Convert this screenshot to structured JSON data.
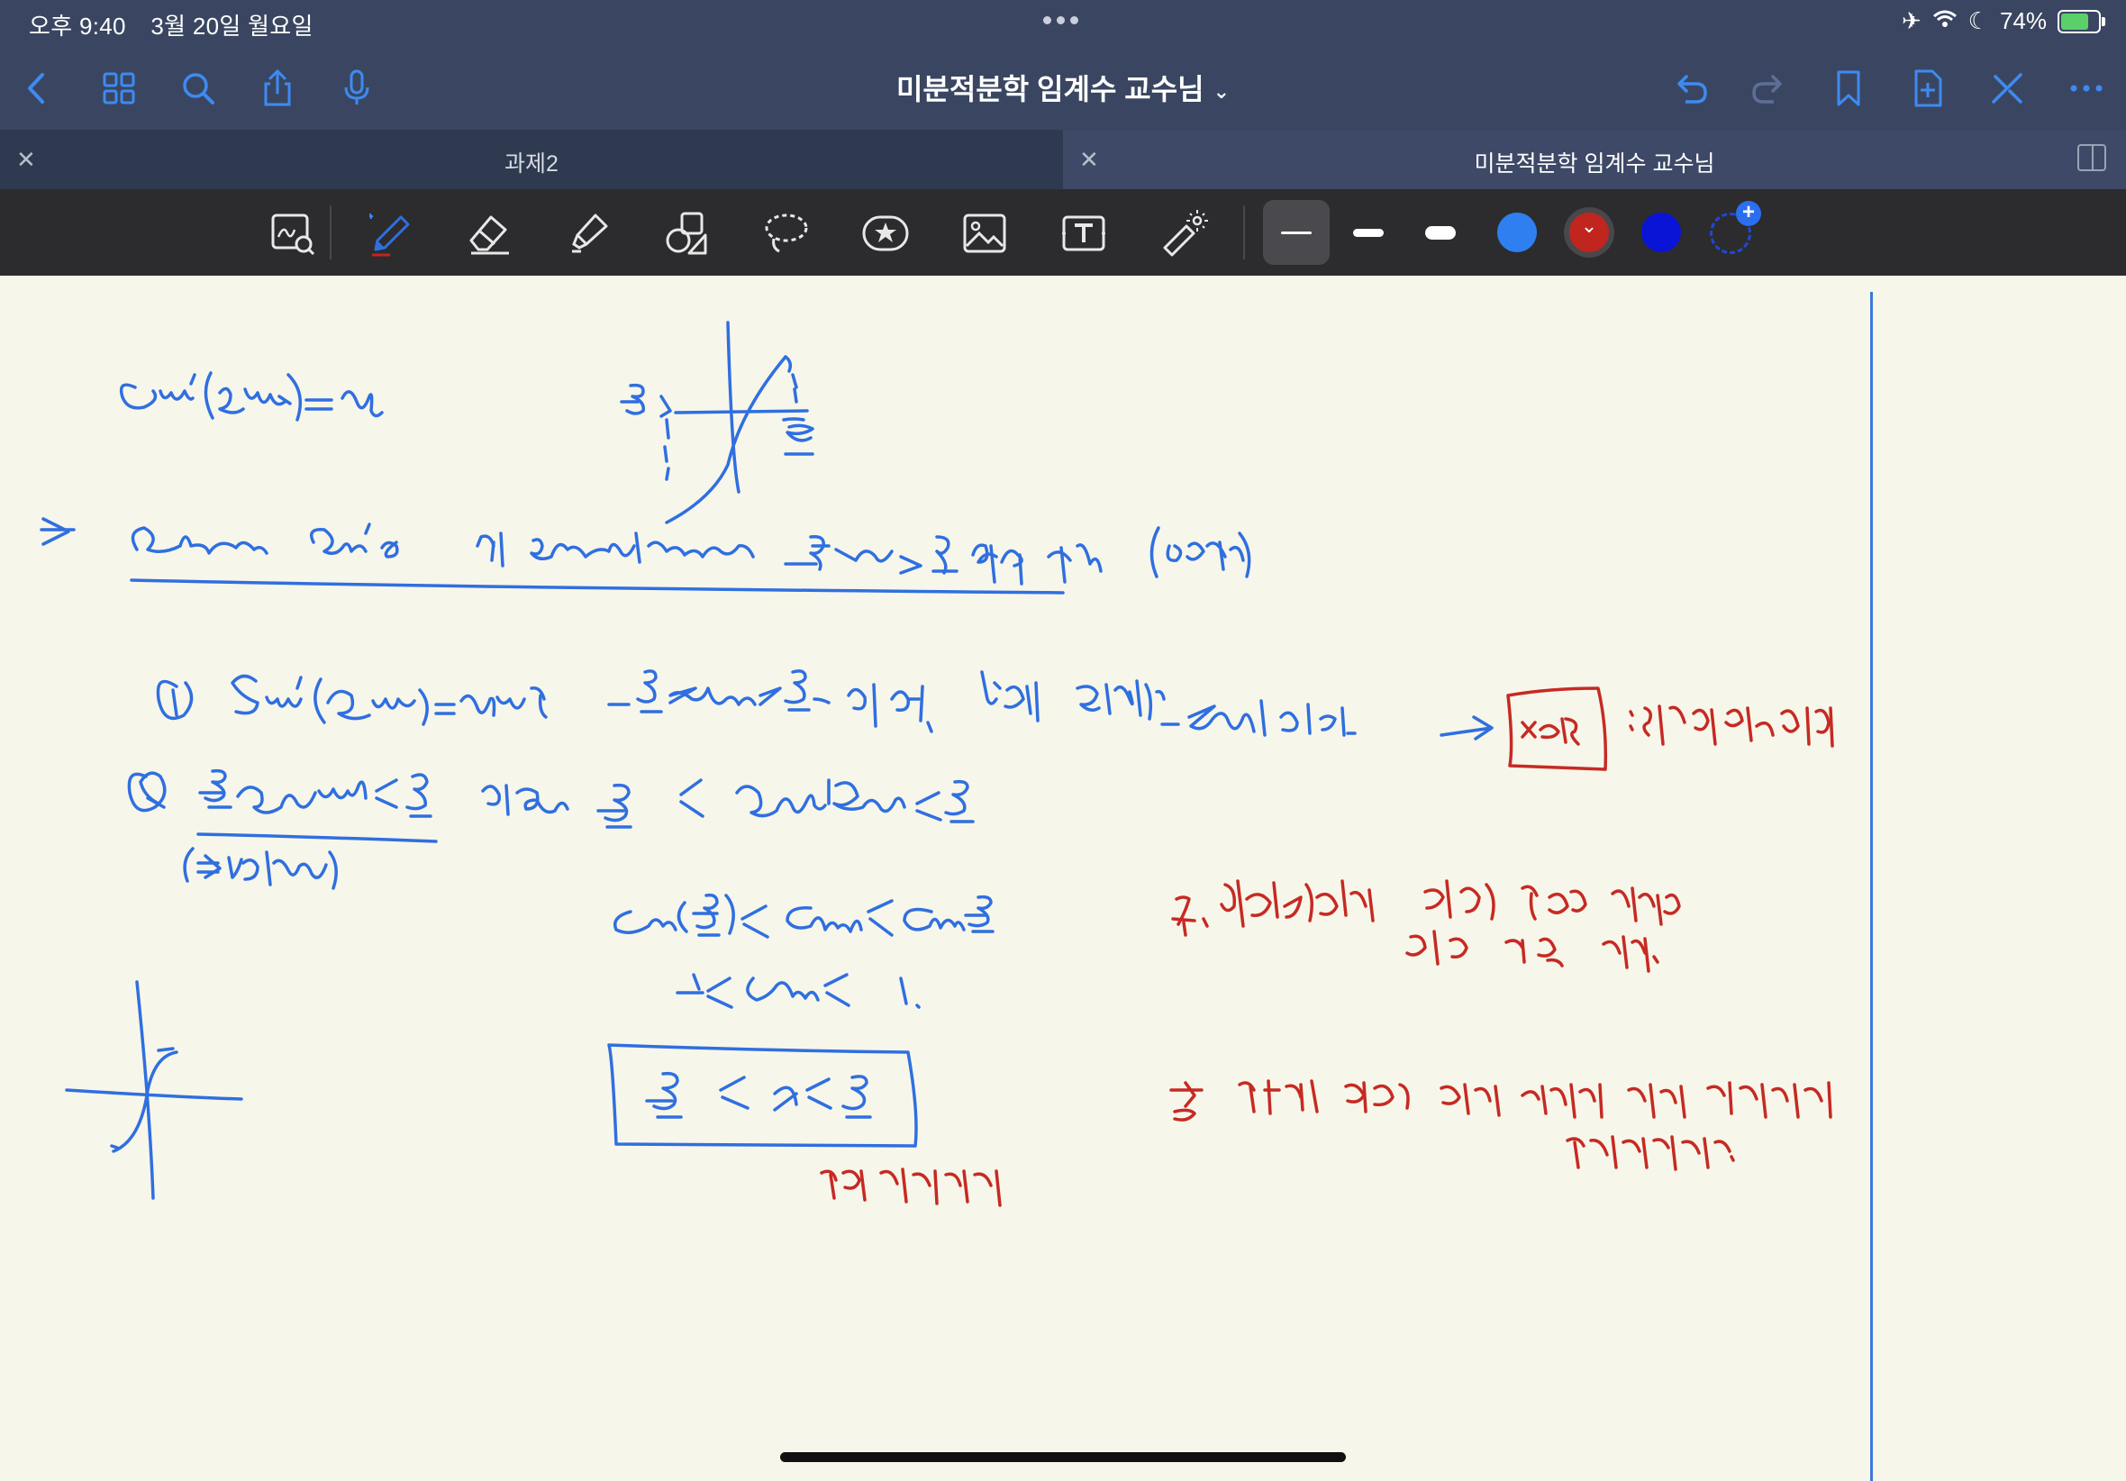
{
  "status": {
    "time": "오후 9:40",
    "date": "3월 20일 월요일",
    "battery": "74%",
    "battery_level": 0.74
  },
  "nav": {
    "title": "미분적분학 임계수 교수님"
  },
  "tabs": [
    {
      "label": "과제2",
      "active": false
    },
    {
      "label": "미분적분학 임계수 교수님",
      "active": true
    }
  ],
  "toolbar": {
    "tools": [
      "zoom-window-icon",
      "pen-icon",
      "eraser-icon",
      "highlighter-icon",
      "shapes-icon",
      "lasso-icon",
      "sticker-icon",
      "image-icon",
      "text-icon",
      "laser-pointer-icon"
    ],
    "stroke_widths": [
      "thin",
      "medium",
      "thick"
    ],
    "colors": [
      "#2f7ff0",
      "#c0251e",
      "#0a14d6"
    ],
    "selected_color": "#c0251e"
  },
  "colors": {
    "ink_blue": "#2f6fe0",
    "ink_red": "#c62a23",
    "bar": "#3a4661",
    "paper": "#f7f6ea"
  }
}
